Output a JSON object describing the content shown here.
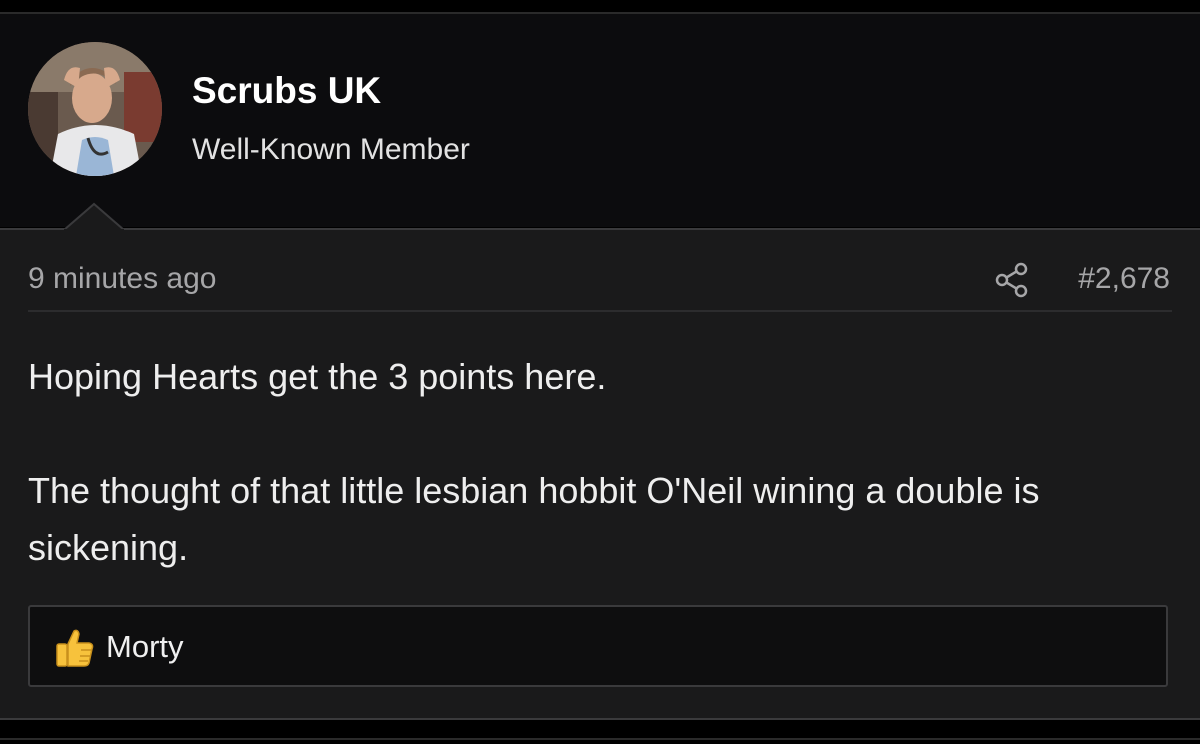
{
  "author": {
    "name": "Scrubs UK",
    "title": "Well-Known Member",
    "avatar_icon": "user-avatar-photo"
  },
  "post": {
    "timestamp": "9 minutes ago",
    "number": "#2,678",
    "share_icon": "share-icon",
    "paragraphs": [
      "Hoping Hearts get the 3 points here.",
      "The thought of that little lesbian hobbit O'Neil wining a double is sickening."
    ]
  },
  "reactions": {
    "icon": "thumbs-up-icon",
    "users": "Morty"
  },
  "colors": {
    "page_bg": "#000000",
    "header_bg": "#0c0c0e",
    "post_bg": "#1a1a1b",
    "reaction_bg": "#0e0e0f",
    "muted_text": "#a6a6a8",
    "like_yellow": "#f7c23c"
  }
}
